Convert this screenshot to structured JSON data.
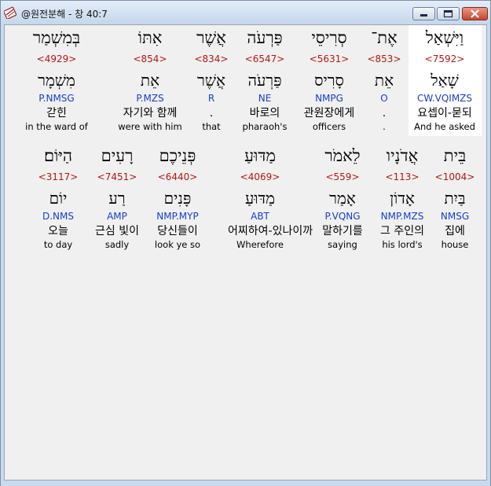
{
  "window": {
    "title": "@원전분해 - 창 40:7",
    "app_icon": "bible-book-icon"
  },
  "rows": [
    [
      {
        "hebrew": "בְּמִשְׁמַר",
        "strong": "<4929>",
        "lemma": "מִשְׁמָר",
        "morph": "P.NMSG",
        "korean": "갇힌",
        "english": "in the ward of"
      },
      {
        "hebrew": "אִתּוֹ",
        "strong": "<854>",
        "lemma": "אֵת",
        "morph": "P.MZS",
        "korean": "자기와 함께",
        "english": "were with him"
      },
      {
        "hebrew": "אֲשֶׁר",
        "strong": "<834>",
        "lemma": "אֲשֶׁר",
        "morph": "R",
        "korean": ".",
        "english": "that"
      },
      {
        "hebrew": "פַּרְעֹה",
        "strong": "<6547>",
        "lemma": "פַּרְעֹה",
        "morph": "NE",
        "korean": "바로의",
        "english": "pharaoh's"
      },
      {
        "hebrew": "סְרִיסֵי",
        "strong": "<5631>",
        "lemma": "סָרִיס",
        "morph": "NMPG",
        "korean": "관원장에게",
        "english": "officers"
      },
      {
        "hebrew": "אֶת־",
        "strong": "<853>",
        "lemma": "אֵת",
        "morph": "O",
        "korean": ".",
        "english": "."
      },
      {
        "hebrew": "וַיִּשְׁאַל",
        "strong": "<7592>",
        "lemma": "שָׁאַל",
        "morph": "CW.VQIMZS",
        "korean": "요셉이-묻되",
        "english": "And he asked",
        "selected": true
      }
    ],
    [
      {
        "hebrew": "הַיּוֹם׃",
        "strong": "<3117>",
        "lemma": "יוֹם",
        "morph": "D.NMS",
        "korean": "오늘",
        "english": "to day"
      },
      {
        "hebrew": "רָעִים",
        "strong": "<7451>",
        "lemma": "רַע",
        "morph": "AMP",
        "korean": "근심 빛이",
        "english": "sadly"
      },
      {
        "hebrew": "פְּנֵיכֶם",
        "strong": "<6440>",
        "lemma": "פָּנִים",
        "morph": "NMP.MYP",
        "korean": "당신들이",
        "english": "look ye so"
      },
      {
        "hebrew": "מַדּוּעַ",
        "strong": "<4069>",
        "lemma": "מַדּוּעַ",
        "morph": "ABT",
        "korean": "어찌하여-있나이까",
        "english": "Wherefore"
      },
      {
        "hebrew": "לֵאמֹר",
        "strong": "<559>",
        "lemma": "אָמַר",
        "morph": "P.VQNG",
        "korean": "말하기를",
        "english": "saying"
      },
      {
        "hebrew": "אֲדֹנָיו",
        "strong": "<113>",
        "lemma": "אָדוֹן",
        "morph": "NMP.MZS",
        "korean": "그 주인의",
        "english": "his lord's"
      },
      {
        "hebrew": "בֵּית",
        "strong": "<1004>",
        "lemma": "בַּיִת",
        "morph": "NMSG",
        "korean": "집에",
        "english": "house"
      }
    ]
  ]
}
